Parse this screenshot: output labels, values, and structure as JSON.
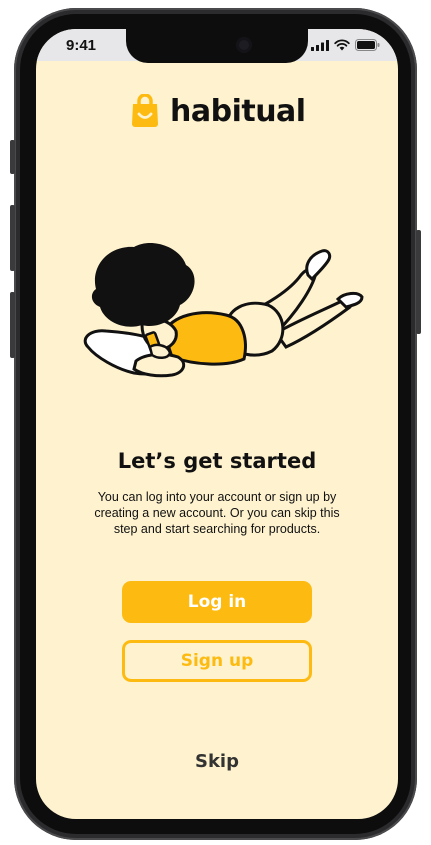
{
  "status_bar": {
    "time": "9:41",
    "icons": [
      "cellular-signal-icon",
      "wifi-icon",
      "battery-icon"
    ]
  },
  "logo": {
    "icon": "shopping-bag-smile-icon",
    "name": "habitual"
  },
  "illustration": {
    "description_icon": "person-lying-with-phone-illustration"
  },
  "onboarding": {
    "heading": "Let’s get started",
    "body": "You can log into your account or sign up by creating a new account. Or you can skip this step and start searching for products."
  },
  "actions": {
    "login_label": "Log in",
    "signup_label": "Sign up",
    "skip_label": "Skip"
  },
  "colors": {
    "background": "#fff3cf",
    "accent": "#fdbb12",
    "text": "#111111"
  }
}
